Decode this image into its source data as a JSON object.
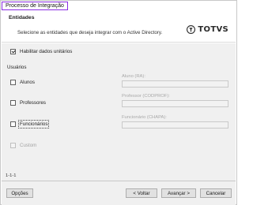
{
  "window": {
    "title": "Processo de Integração"
  },
  "header": {
    "title": "Entidades",
    "description": "Selecione as entidades que deseja integrar com o Active Directory.",
    "logo_text": "TOTVS"
  },
  "options": {
    "enable_unit_data": {
      "label": "Habilitar dados unitários",
      "checked": true
    }
  },
  "users_group": {
    "title": "Usuários",
    "entities": [
      {
        "label": "Alunos",
        "checked": false,
        "field_label": "Aluno (RA):",
        "field_value": ""
      },
      {
        "label": "Professores",
        "checked": false,
        "field_label": "Professor (CODPROF):",
        "field_value": ""
      },
      {
        "label": "Funcionários",
        "checked": false,
        "field_label": "Funcionário (CHAPA):",
        "field_value": ""
      },
      {
        "label": "Custom",
        "checked": false,
        "disabled": true
      }
    ]
  },
  "footer": {
    "page_indicator": "1-1-1",
    "options_label": "Opções",
    "back_label": "< Voltar",
    "next_label": "Avançar >",
    "cancel_label": "Cancelar"
  }
}
